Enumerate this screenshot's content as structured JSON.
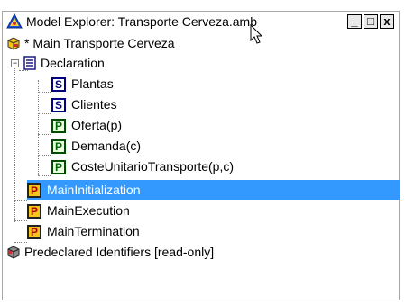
{
  "window": {
    "title": "Model Explorer: Transporte Cerveza.amb",
    "buttons": {
      "minimize": "_",
      "maximize": "□",
      "close": "x"
    }
  },
  "tree": {
    "root": {
      "label": "* Main Transporte Cerveza",
      "icon": "model-package-icon"
    },
    "declaration": {
      "label": "Declaration",
      "icon": "declaration-book-icon",
      "expander": "−"
    },
    "declaration_items": [
      {
        "label": "Plantas",
        "icon_letter": "S",
        "kind": "set"
      },
      {
        "label": "Clientes",
        "icon_letter": "S",
        "kind": "set"
      },
      {
        "label": "Oferta(p)",
        "icon_letter": "P",
        "kind": "parameter"
      },
      {
        "label": "Demanda(c)",
        "icon_letter": "P",
        "kind": "parameter"
      },
      {
        "label": "CosteUnitarioTransporte(p,c)",
        "icon_letter": "P",
        "kind": "parameter"
      }
    ],
    "procedures": [
      {
        "label": "MainInitialization",
        "icon_letter": "P",
        "selected": true
      },
      {
        "label": "MainExecution",
        "icon_letter": "P",
        "selected": false
      },
      {
        "label": "MainTermination",
        "icon_letter": "P",
        "selected": false
      }
    ],
    "predeclared": {
      "label": "Predeclared Identifiers [read-only]",
      "icon": "predeclared-box-icon"
    }
  },
  "colors": {
    "selection": "#3399ff",
    "set_icon": "#000080",
    "parameter_icon": "#006400",
    "procedure_icon": "#f3c61c"
  }
}
